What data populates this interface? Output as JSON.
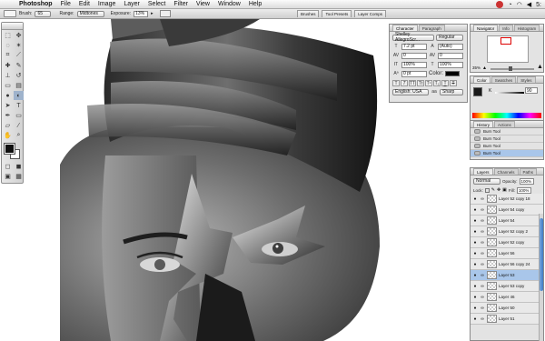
{
  "menubar": {
    "items": [
      "Photoshop",
      "File",
      "Edit",
      "Image",
      "Layer",
      "Select",
      "Filter",
      "View",
      "Window",
      "Help"
    ],
    "clock": "5:"
  },
  "options": {
    "brush_label": "Brush:",
    "brush_size": "65",
    "range_label": "Range:",
    "range_value": "Midtones",
    "exposure_label": "Exposure:",
    "exposure_value": "13%",
    "well_tabs": [
      "Brushes",
      "Tool Presets",
      "Layer Comps"
    ]
  },
  "character": {
    "tabs": [
      "Character",
      "Paragraph"
    ],
    "font_family": "Shelley AllegroScr...",
    "font_style": "Regular",
    "size": "7.2 pt",
    "leading": "(Auto)",
    "kerning": "0",
    "tracking": "0",
    "v_scale": "100%",
    "h_scale": "100%",
    "baseline": "0 pt",
    "color_label": "Color:",
    "language": "English: USA",
    "antialias": "Sharp"
  },
  "navigator": {
    "tabs": [
      "Navigator",
      "Info",
      "Histogram"
    ],
    "zoom": "35%"
  },
  "color_panel": {
    "tabs": [
      "Color",
      "Swatches",
      "Styles"
    ],
    "k_label": "K",
    "k_value": "90"
  },
  "history": {
    "tabs": [
      "History",
      "Actions"
    ],
    "items": [
      "Burn Tool",
      "Burn Tool",
      "Burn Tool",
      "Burn Tool"
    ]
  },
  "layers": {
    "tabs": [
      "Layers",
      "Channels",
      "Paths"
    ],
    "blend_mode": "Normal",
    "opacity_label": "Opacity:",
    "opacity_value": "100%",
    "lock_label": "Lock:",
    "fill_label": "Fill:",
    "fill_value": "100%",
    "items": [
      "Layer 52 copy 18",
      "Layer 54 copy",
      "Layer 54",
      "Layer 52 copy 2",
      "Layer 52 copy",
      "Layer 56",
      "Layer 56 copy 24",
      "Layer 53",
      "Layer 53 copy",
      "Layer 46",
      "Layer 50",
      "Layer 51"
    ],
    "selected_index": 7
  }
}
